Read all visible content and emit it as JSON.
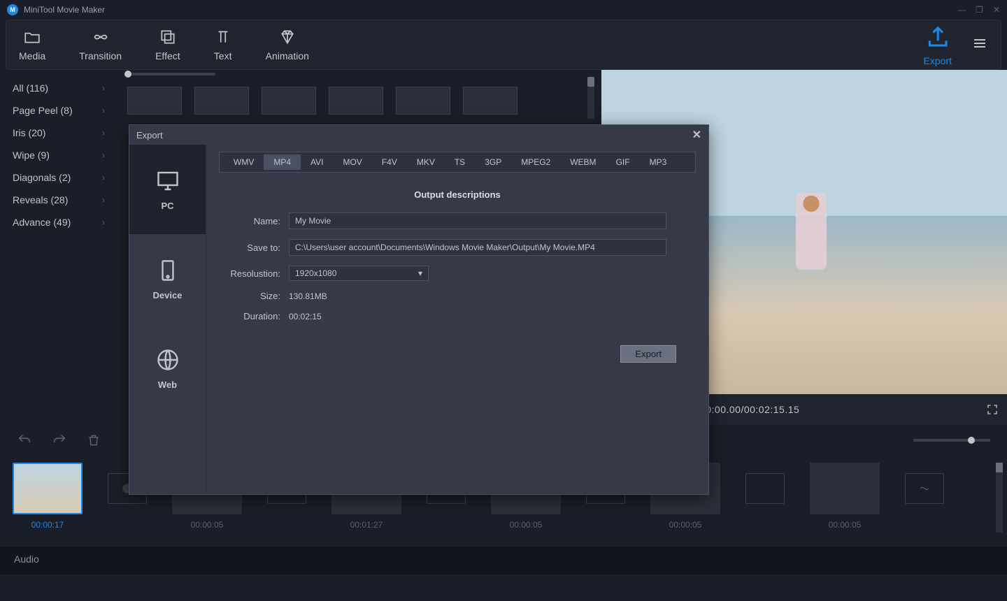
{
  "app": {
    "title": "MiniTool Movie Maker",
    "logo_letter": "M"
  },
  "toolbar": {
    "media": "Media",
    "transition": "Transition",
    "effect": "Effect",
    "text": "Text",
    "animation": "Animation",
    "export": "Export"
  },
  "sidebar": {
    "items": [
      {
        "label": "All (116)"
      },
      {
        "label": "Page Peel (8)"
      },
      {
        "label": "Iris (20)"
      },
      {
        "label": "Wipe (9)"
      },
      {
        "label": "Diagonals (2)"
      },
      {
        "label": "Reveals (28)"
      },
      {
        "label": "Advance (49)"
      }
    ]
  },
  "preview": {
    "timecode": "00:00:00.00/00:02:15.15"
  },
  "timeline": {
    "clips": [
      {
        "duration": "00:00:17",
        "selected": true
      },
      {
        "duration": "00:00:05",
        "thumb": "f-pink"
      },
      {
        "duration": "",
        "thumb": "f-noise",
        "fx": true
      },
      {
        "duration": "00:01:27",
        "thumb": "f-white"
      },
      {
        "duration": "",
        "thumb": "f-diag",
        "fx": true
      },
      {
        "duration": "00:00:05",
        "thumb": "f-room"
      },
      {
        "duration": "",
        "thumb": "f-lines",
        "fx": true
      },
      {
        "duration": "00:00:05",
        "thumb": "f-people"
      },
      {
        "duration": "",
        "thumb": "f-wave",
        "fx": true
      },
      {
        "duration": "00:00:05",
        "thumb": "f-kitchen"
      }
    ],
    "audio_label": "Audio"
  },
  "export_dialog": {
    "title": "Export",
    "side": {
      "pc": "PC",
      "device": "Device",
      "web": "Web"
    },
    "formats": [
      "WMV",
      "MP4",
      "AVI",
      "MOV",
      "F4V",
      "MKV",
      "TS",
      "3GP",
      "MPEG2",
      "WEBM",
      "GIF",
      "MP3"
    ],
    "active_format": "MP4",
    "heading": "Output descriptions",
    "labels": {
      "name": "Name:",
      "save_to": "Save to:",
      "resolution": "Resolustion:",
      "size": "Size:",
      "duration": "Duration:"
    },
    "values": {
      "name": "My Movie",
      "save_to": "C:\\Users\\user account\\Documents\\Windows Movie Maker\\Output\\My Movie.MP4",
      "resolution": "1920x1080",
      "size": "130.81MB",
      "duration": "00:02:15"
    },
    "export_button": "Export"
  }
}
